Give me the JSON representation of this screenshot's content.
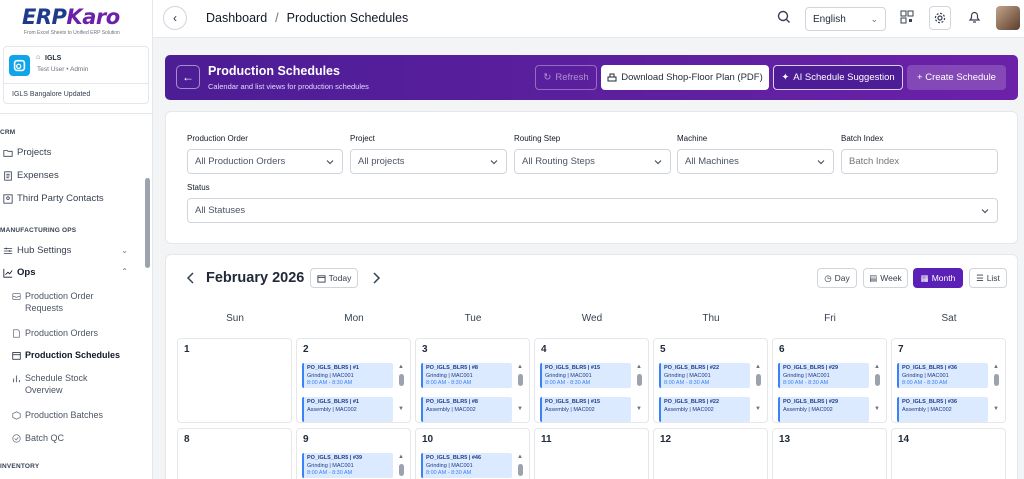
{
  "sidebar": {
    "logo": "ERPKaro",
    "logo_tag": "From Excel Sheets to Unified ERP Solution",
    "org": {
      "name": "IGLS",
      "user": "Test User • Admin",
      "branch": "IGLS Bangalore Updated"
    },
    "sections": {
      "crm": "CRM",
      "mfg": "MANUFACTURING OPS",
      "inventory": "INVENTORY"
    },
    "crm_items": [
      "Projects",
      "Expenses",
      "Third Party Contacts"
    ],
    "hub_settings": "Hub Settings",
    "ops": "Ops",
    "ops_items": [
      "Production Order Requests",
      "Production Orders",
      "Production Schedules",
      "Schedule Stock Overview",
      "Production Batches",
      "Batch QC"
    ]
  },
  "topbar": {
    "breadcrumb_root": "Dashboard",
    "breadcrumb_sep": "/",
    "breadcrumb_current": "Production Schedules",
    "language": "English"
  },
  "hero": {
    "title": "Production Schedules",
    "subtitle": "Calendar and list views for production schedules",
    "refresh": "Refresh",
    "pdf": "Download Shop-Floor Plan (PDF)",
    "ai": "AI Schedule Suggestion",
    "create": "+ Create Schedule"
  },
  "filters": {
    "production_order": {
      "label": "Production Order",
      "value": "All Production Orders"
    },
    "project": {
      "label": "Project",
      "value": "All projects"
    },
    "routing_step": {
      "label": "Routing Step",
      "value": "All Routing Steps"
    },
    "machine": {
      "label": "Machine",
      "value": "All Machines"
    },
    "batch_index": {
      "label": "Batch Index",
      "placeholder": "Batch Index"
    },
    "status": {
      "label": "Status",
      "value": "All Statuses"
    }
  },
  "calendar": {
    "month": "February 2026",
    "today": "Today",
    "views": {
      "day": "Day",
      "week": "Week",
      "month": "Month",
      "list": "List"
    },
    "active_view": "Month",
    "weekdays": [
      "Sun",
      "Mon",
      "Tue",
      "Wed",
      "Thu",
      "Fri",
      "Sat"
    ],
    "week1": [
      "1",
      "2",
      "3",
      "4",
      "5",
      "6",
      "7"
    ],
    "week2": [
      "8",
      "9",
      "10",
      "11",
      "12",
      "13",
      "14"
    ],
    "events": {
      "d2": [
        [
          "PO_IGLS_BLR5 | #1",
          "Grinding | MAC001",
          "8:00 AM - 8:30 AM"
        ],
        [
          "PO_IGLS_BLR5 | #1",
          "Assembly | MAC002"
        ]
      ],
      "d3": [
        [
          "PO_IGLS_BLR5 | #8",
          "Grinding | MAC001",
          "8:00 AM - 8:30 AM"
        ],
        [
          "PO_IGLS_BLR5 | #8",
          "Assembly | MAC002"
        ]
      ],
      "d4": [
        [
          "PO_IGLS_BLR5 | #15",
          "Grinding | MAC001",
          "8:00 AM - 8:30 AM"
        ],
        [
          "PO_IGLS_BLR5 | #15",
          "Assembly | MAC002"
        ]
      ],
      "d5": [
        [
          "PO_IGLS_BLR5 | #22",
          "Grinding | MAC001",
          "8:00 AM - 8:30 AM"
        ],
        [
          "PO_IGLS_BLR5 | #22",
          "Assembly | MAC002"
        ]
      ],
      "d6": [
        [
          "PO_IGLS_BLR5 | #29",
          "Grinding | MAC001",
          "8:00 AM - 8:30 AM"
        ],
        [
          "PO_IGLS_BLR5 | #29",
          "Assembly | MAC002"
        ]
      ],
      "d7": [
        [
          "PO_IGLS_BLR5 | #36",
          "Grinding | MAC001",
          "8:00 AM - 8:30 AM"
        ],
        [
          "PO_IGLS_BLR5 | #36",
          "Assembly | MAC002"
        ]
      ],
      "d9": [
        [
          "PO_IGLS_BLR5 | #39",
          "Grinding | MAC001",
          "8:00 AM - 8:30 AM"
        ]
      ],
      "d10": [
        [
          "PO_IGLS_BLR5 | #46",
          "Grinding | MAC001",
          "8:00 AM - 8:30 AM"
        ]
      ]
    }
  },
  "colors": {
    "brand_purple": "#5b21b6",
    "event_bg": "#dbeafe",
    "event_accent": "#3b82f6"
  }
}
